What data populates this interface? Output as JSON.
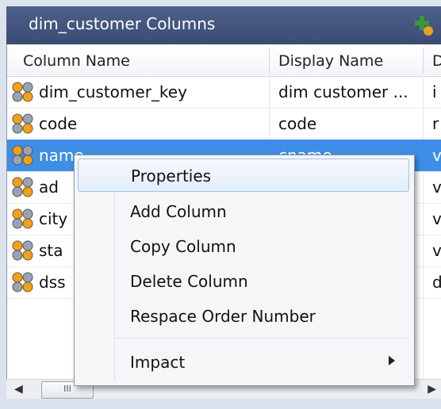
{
  "panel": {
    "title": "dim_customer Columns",
    "title_icon": "add-column-icon"
  },
  "columns": [
    "Column Name",
    "Display Name",
    "D"
  ],
  "rows": [
    {
      "name": "dim_customer_key",
      "display": "dim customer ...",
      "extra": "i",
      "selected": false
    },
    {
      "name": "code",
      "display": "code",
      "extra": "r",
      "selected": false
    },
    {
      "name": "name",
      "display": "cname",
      "extra": "v",
      "selected": true
    },
    {
      "name": "ad",
      "display": "",
      "extra": "v",
      "selected": false
    },
    {
      "name": "city",
      "display": "",
      "extra": "v",
      "selected": false
    },
    {
      "name": "sta",
      "display": "",
      "extra": "v",
      "selected": false
    },
    {
      "name": "dss",
      "display": "",
      "extra": "d",
      "selected": false
    }
  ],
  "scrollbar": {
    "thumb_grip": "III"
  },
  "context_menu": {
    "items": [
      {
        "label": "Properties",
        "highlighted": true
      },
      {
        "label": "Add Column"
      },
      {
        "label": "Copy Column"
      },
      {
        "label": "Delete Column"
      },
      {
        "label": "Respace Order Number"
      },
      {
        "label": "Impact",
        "submenu": true
      }
    ]
  },
  "colors": {
    "title_bg": "#3f5078",
    "selection": "#3e8ee6",
    "menu_highlight": "#e3eefb"
  }
}
